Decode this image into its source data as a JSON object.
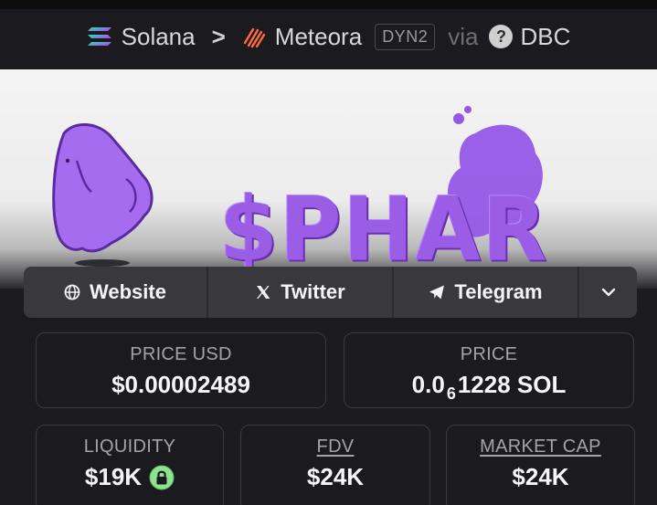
{
  "breadcrumb": {
    "chain": "Solana",
    "separator": ">",
    "dex": "Meteora",
    "dex_badge": "DYN2",
    "via": "via",
    "via_icon": "question-icon",
    "source": "DBC"
  },
  "banner": {
    "ticker": "$PHAR"
  },
  "links": {
    "website": "Website",
    "twitter": "Twitter",
    "telegram": "Telegram",
    "more_icon": "chevron-down-icon"
  },
  "stats": {
    "price_usd": {
      "label": "PRICE USD",
      "value": "$0.00002489"
    },
    "price": {
      "label": "PRICE",
      "prefix": "0.0",
      "zeros": "6",
      "suffix": "1228 SOL"
    },
    "liquidity": {
      "label": "LIQUIDITY",
      "value": "$19K"
    },
    "fdv": {
      "label": "FDV",
      "value": "$24K"
    },
    "market_cap": {
      "label": "MARKET CAP",
      "value": "$24K"
    }
  },
  "colors": {
    "background": "#1b1b1f",
    "panel": "#38383d",
    "accent_purple": "#9b5de5",
    "lock_green": "#8fe28f"
  }
}
